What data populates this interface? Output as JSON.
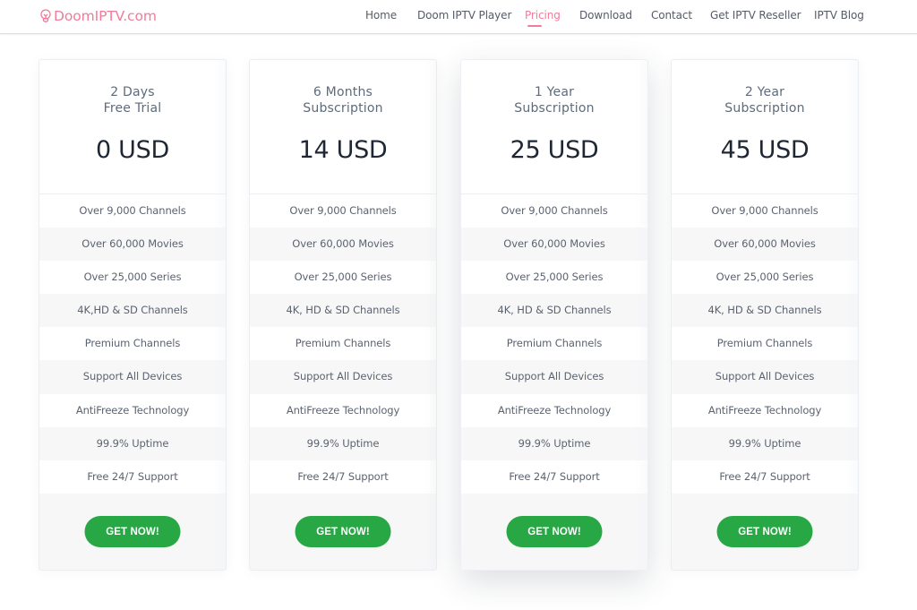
{
  "header": {
    "logo_text": "DoomIPTV.com",
    "logo_icon": "lightbulb-icon",
    "brand_color": "#f07c9a",
    "nav": [
      {
        "label": "Home",
        "active": false
      },
      {
        "label": "Doom IPTV Player",
        "active": false
      },
      {
        "label": "Pricing",
        "active": true
      },
      {
        "label": "Download",
        "active": false
      },
      {
        "label": "Contact",
        "active": false
      },
      {
        "label": "Get IPTV Reseller",
        "active": false
      },
      {
        "label": "IPTV Blog",
        "active": false
      }
    ]
  },
  "plans": [
    {
      "title_line1": "2 Days",
      "title_line2": "Free Trial",
      "price": "0 USD",
      "featured": false,
      "features": [
        "Over 9,000 Channels",
        "Over 60,000 Movies",
        "Over 25,000 Series",
        "4K,HD & SD Channels",
        "Premium Channels",
        "Support All Devices",
        "AntiFreeze Technology",
        "99.9% Uptime",
        "Free 24/7 Support"
      ],
      "button_label": "GET NOW!"
    },
    {
      "title_line1": "6 Months",
      "title_line2": "Subscription",
      "price": "14 USD",
      "featured": false,
      "features": [
        "Over 9,000 Channels",
        "Over 60,000 Movies",
        "Over 25,000 Series",
        "4K, HD & SD Channels",
        "Premium Channels",
        "Support All Devices",
        "AntiFreeze Technology",
        "99.9% Uptime",
        "Free 24/7 Support"
      ],
      "button_label": "GET NOW!"
    },
    {
      "title_line1": "1 Year",
      "title_line2": "Subscription",
      "price": "25 USD",
      "featured": true,
      "features": [
        "Over 9,000 Channels",
        "Over 60,000 Movies",
        "Over 25,000 Series",
        "4K, HD & SD Channels",
        "Premium Channels",
        "Support All Devices",
        "AntiFreeze Technology",
        "99.9% Uptime",
        "Free 24/7 Support"
      ],
      "button_label": "GET NOW!"
    },
    {
      "title_line1": "2 Year",
      "title_line2": "Subscription",
      "price": "45 USD",
      "featured": false,
      "features": [
        "Over 9,000 Channels",
        "Over 60,000 Movies",
        "Over 25,000 Series",
        "4K, HD & SD Channels",
        "Premium Channels",
        "Support All Devices",
        "AntiFreeze Technology",
        "99.9% Uptime",
        "Free 24/7 Support"
      ],
      "button_label": "GET NOW!"
    }
  ],
  "colors": {
    "button": "#28a745",
    "active_nav": "#f07c9a"
  }
}
